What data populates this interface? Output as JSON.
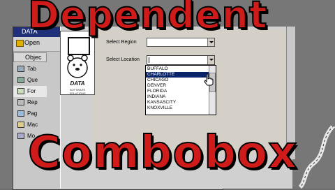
{
  "overlay": {
    "title_top": "Dependent",
    "title_bottom": "Combobox"
  },
  "db_window": {
    "title": "DATA",
    "open_label": "Open",
    "objects_label": "Objec",
    "objects": [
      {
        "icon": "table-icon",
        "label": "Tab"
      },
      {
        "icon": "query-icon",
        "label": "Que"
      },
      {
        "icon": "form-icon",
        "label": "For",
        "selected": true
      },
      {
        "icon": "report-icon",
        "label": "Rep"
      },
      {
        "icon": "page-icon",
        "label": "Pag"
      },
      {
        "icon": "macro-icon",
        "label": "Mac"
      },
      {
        "icon": "module-icon",
        "label": "Mo"
      }
    ]
  },
  "logo": {
    "text": "DATA",
    "subtext": "SOFTWARE SOLUTIONS"
  },
  "form": {
    "region_label": "Select Region",
    "region_value": "",
    "location_label": "Select Location",
    "location_value": "",
    "location_options": [
      "BUFFALO",
      "CHARLOTTE",
      "CHICAGO",
      "DENVER",
      "FLORIDA",
      "INDIANA",
      "KANSASCITY",
      "KNOXVILLE"
    ],
    "selected_option": "CHARLOTTE"
  },
  "colors": {
    "title_red": "#d01b1b",
    "selection_blue": "#0a246a"
  }
}
